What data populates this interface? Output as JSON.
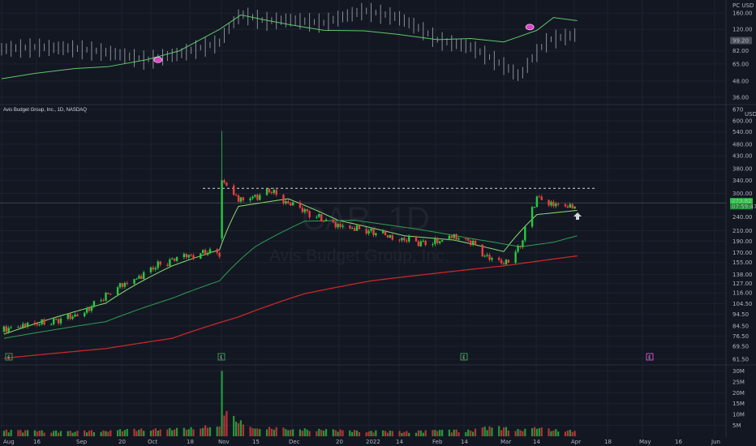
{
  "header": {
    "symbol_title": "Avis Budget Group, Inc., 1D, NASDAQ"
  },
  "watermark": {
    "ticker": "CAR, 1D",
    "company": "Avis Budget Group, Inc."
  },
  "colors": {
    "background": "#131722",
    "up": "#26c940",
    "down": "#ef3d3d",
    "ema_fast": "#8ae074",
    "ema_mid": "#2e9e52",
    "ema_slow": "#c62828",
    "rs_line": "#5cc96a",
    "grid": "#1e2230",
    "marker": "#d946c4"
  },
  "chart_data": [
    {
      "type": "line",
      "pane": "relative-strength",
      "title": "",
      "scale": "log",
      "ylim": [
        34,
        180
      ],
      "y_ticks": [
        "160.00",
        "120.00",
        "82.00",
        "65.00",
        "48.00",
        "36.00"
      ],
      "price_label": "99.20",
      "axis_corner_label": "PC USD",
      "series": [
        {
          "style": "bars",
          "x": [
            "Aug 1",
            "Aug 15",
            "Sep 1",
            "Sep 15",
            "Oct 1",
            "Oct 15",
            "Nov 1",
            "Nov 10",
            "Nov 20",
            "Dec 1",
            "Dec 15",
            "Jan 1",
            "Jan 15",
            "Feb 1",
            "Feb 15",
            "Feb 25",
            "Mar 8",
            "Mar 20",
            "Apr 1"
          ],
          "values": [
            85,
            88,
            86,
            80,
            70,
            78,
            95,
            158,
            140,
            142,
            135,
            168,
            150,
            100,
            88,
            70,
            52,
            100,
            110
          ]
        },
        {
          "style": "line",
          "x": [
            "Aug 1",
            "Aug 15",
            "Sep 1",
            "Sep 15",
            "Oct 1",
            "Oct 15",
            "Nov 1",
            "Nov 10",
            "Nov 20",
            "Dec 1",
            "Dec 15",
            "Jan 1",
            "Jan 15",
            "Feb 1",
            "Feb 15",
            "Mar 1",
            "Mar 15",
            "Mar 22",
            "Apr 1"
          ],
          "values": [
            50,
            55,
            60,
            62,
            70,
            82,
            120,
            155,
            142,
            130,
            118,
            117,
            110,
            100,
            102,
            96,
            118,
            148,
            140
          ]
        }
      ],
      "markers": [
        {
          "x": "Oct 6",
          "y": 70
        },
        {
          "x": "Mar 12",
          "y": 125
        }
      ]
    },
    {
      "type": "candlestick",
      "pane": "price",
      "title": "Avis Budget Group, Inc., 1D, NASDAQ",
      "scale": "log",
      "ylim": [
        60,
        680
      ],
      "y_ticks": [
        "670",
        "600.00",
        "540.00",
        "480.00",
        "430.00",
        "380.00",
        "340.00",
        "300.00",
        "240.00",
        "210.00",
        "190.00",
        "170.00",
        "155.00",
        "138.00",
        "127.00",
        "116.00",
        "104.50",
        "94.50",
        "84.50",
        "76.50",
        "69.50",
        "61.50"
      ],
      "last_price_label": "273.82",
      "countdown_label": "07:59:47",
      "axis_corner_label": "USD",
      "x_ticks": [
        "Aug",
        "16",
        "Sep",
        "20",
        "Oct",
        "18",
        "Nov",
        "15",
        "Dec",
        "20",
        "2022",
        "14",
        "Feb",
        "14",
        "Mar",
        "14",
        "Apr",
        "18",
        "May",
        "16",
        "Jun"
      ],
      "resistance_line": 315,
      "series": [
        {
          "name": "",
          "kind": "ohlc",
          "x": [
            "Aug 2",
            "Aug 9",
            "Aug 16",
            "Aug 23",
            "Aug 30",
            "Sep 7",
            "Sep 14",
            "Sep 21",
            "Sep 28",
            "Oct 5",
            "Oct 12",
            "Oct 19",
            "Oct 26",
            "Nov 1",
            "Nov 2",
            "Nov 9",
            "Nov 16",
            "Nov 23",
            "Nov 30",
            "Dec 7",
            "Dec 14",
            "Dec 21",
            "Dec 28",
            "Jan 4",
            "Jan 11",
            "Jan 18",
            "Jan 25",
            "Feb 1",
            "Feb 8",
            "Feb 15",
            "Feb 22",
            "Mar 1",
            "Mar 8",
            "Mar 15",
            "Mar 22",
            "Mar 29",
            "Apr 1"
          ],
          "open": [
            80,
            82,
            85,
            86,
            88,
            92,
            100,
            112,
            125,
            135,
            150,
            158,
            165,
            172,
            195,
            305,
            280,
            290,
            310,
            270,
            250,
            232,
            220,
            212,
            205,
            200,
            193,
            185,
            188,
            198,
            185,
            165,
            160,
            185,
            290,
            265,
            262
          ],
          "high": [
            86,
            88,
            90,
            92,
            96,
            104,
            115,
            128,
            140,
            155,
            162,
            168,
            178,
            185,
            545,
            320,
            300,
            318,
            320,
            278,
            258,
            240,
            228,
            218,
            212,
            205,
            200,
            195,
            210,
            208,
            192,
            180,
            195,
            300,
            305,
            275,
            272
          ],
          "low": [
            76,
            80,
            82,
            84,
            86,
            90,
            98,
            108,
            120,
            130,
            145,
            152,
            160,
            168,
            190,
            270,
            265,
            275,
            265,
            245,
            232,
            218,
            210,
            203,
            198,
            190,
            180,
            175,
            180,
            185,
            158,
            145,
            155,
            180,
            262,
            255,
            255
          ],
          "close": [
            82,
            85,
            86,
            88,
            92,
            100,
            112,
            125,
            135,
            150,
            158,
            165,
            172,
            170,
            340,
            280,
            290,
            310,
            272,
            252,
            235,
            222,
            214,
            207,
            200,
            194,
            186,
            188,
            200,
            190,
            162,
            152,
            182,
            290,
            268,
            262,
            274
          ]
        },
        {
          "name": "",
          "style": "ema_fast",
          "x": [
            "Aug 2",
            "Sep 14",
            "Oct 12",
            "Nov 1",
            "Nov 9",
            "Nov 30",
            "Dec 21",
            "Jan 18",
            "Feb 8",
            "Mar 1",
            "Mar 15",
            "Apr 1"
          ],
          "values": [
            78,
            105,
            150,
            175,
            265,
            285,
            232,
            200,
            192,
            172,
            245,
            255
          ]
        },
        {
          "name": "",
          "style": "ema_mid",
          "x": [
            "Aug 2",
            "Sep 14",
            "Oct 12",
            "Nov 1",
            "Nov 16",
            "Dec 7",
            "Dec 28",
            "Jan 25",
            "Feb 15",
            "Mar 8",
            "Mar 22",
            "Apr 1"
          ],
          "values": [
            75,
            88,
            110,
            130,
            180,
            230,
            232,
            212,
            195,
            180,
            188,
            200
          ]
        },
        {
          "name": "",
          "style": "ema_slow",
          "x": [
            "Aug 2",
            "Sep 14",
            "Oct 12",
            "Nov 9",
            "Dec 7",
            "Jan 4",
            "Feb 1",
            "Mar 1",
            "Apr 1"
          ],
          "values": [
            62,
            68,
            75,
            92,
            115,
            130,
            140,
            150,
            165
          ]
        }
      ],
      "event_flags": [
        "E",
        "E",
        "E",
        "E"
      ]
    },
    {
      "type": "bar",
      "pane": "volume",
      "title": "",
      "ylim": [
        0,
        32
      ],
      "y_ticks": [
        "30M",
        "25M",
        "20M",
        "15M",
        "10M",
        "5M"
      ],
      "unit": "M",
      "x": [
        "Aug 2",
        "Aug 16",
        "Sep 1",
        "Sep 14",
        "Oct 1",
        "Oct 18",
        "Nov 1",
        "Nov 2",
        "Nov 3",
        "Nov 9",
        "Nov 16",
        "Dec 1",
        "Dec 15",
        "Jan 3",
        "Jan 18",
        "Feb 1",
        "Feb 15",
        "Feb 24",
        "Mar 8",
        "Mar 15",
        "Mar 22",
        "Apr 1"
      ],
      "values": [
        2.5,
        2.2,
        2.0,
        2.4,
        2.8,
        3.0,
        4.5,
        30,
        9.5,
        6.0,
        3.5,
        3.0,
        2.6,
        2.2,
        2.0,
        2.4,
        2.6,
        4.0,
        2.8,
        3.4,
        2.6,
        2.2
      ]
    }
  ]
}
